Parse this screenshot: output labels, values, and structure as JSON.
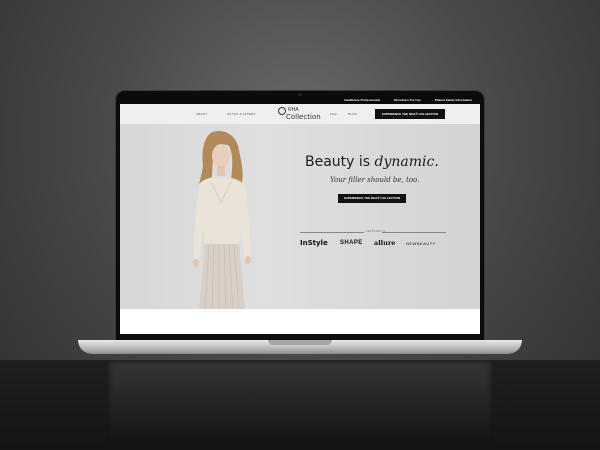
{
  "topbar": {
    "links": [
      "Healthcare Professionals",
      "Directions For Use",
      "Patient Safety Information"
    ]
  },
  "nav": {
    "items_left": [
      "ABOUT",
      "MYTHS & AFTERS"
    ],
    "items_right": [
      "FAQ",
      "BLOG"
    ],
    "logo_line1": "RHA",
    "logo_line2": "Collection",
    "cta": "EXPERIENCE THE RHA® COLLECTION"
  },
  "hero": {
    "headline_plain": "Beauty is ",
    "headline_italic": "dynamic.",
    "subheadline": "Your filler should be, too.",
    "cta": "EXPERIENCE THE RHA® COLLECTION",
    "featured_label": "FEATURED IN",
    "publications": [
      "InStyle",
      "SHAPE",
      "allure",
      "NEWBEAUTY"
    ]
  },
  "colors": {
    "accent": "#111111",
    "hero_background": "#dcdcdc"
  }
}
